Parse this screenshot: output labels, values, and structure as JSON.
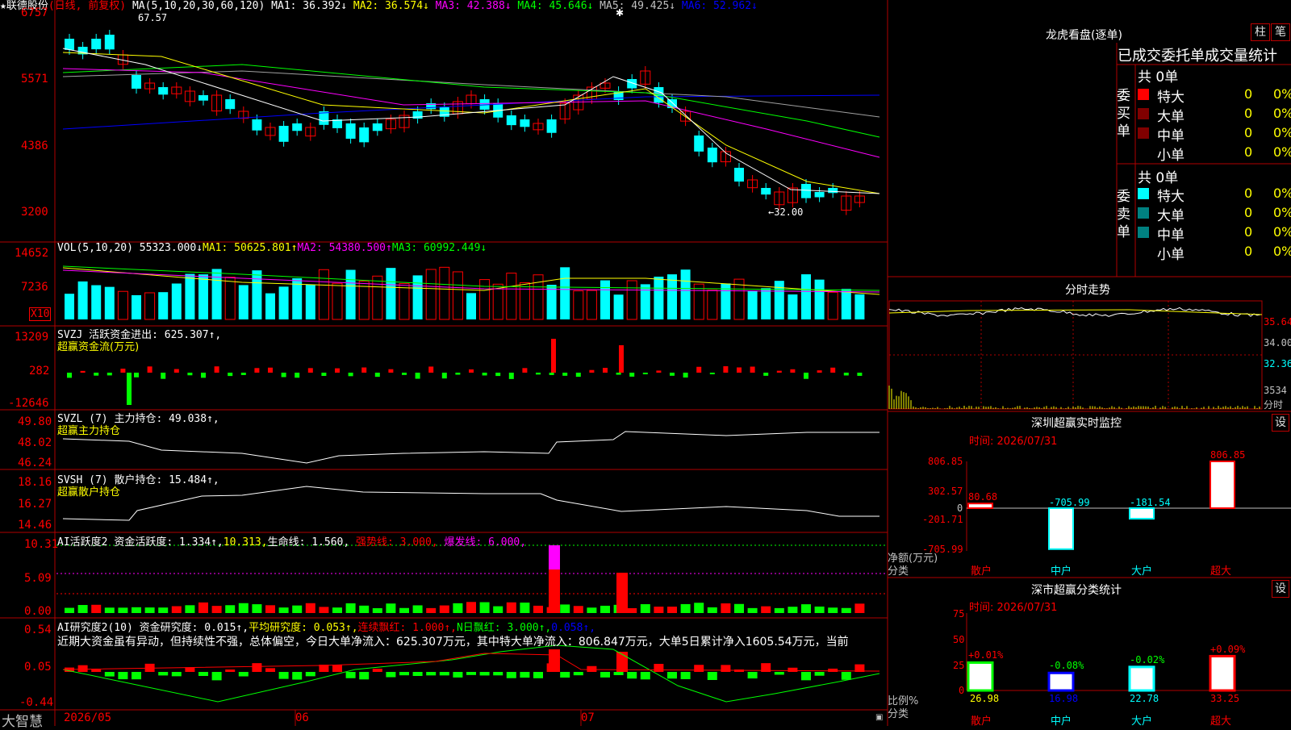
{
  "colors": {
    "up": "#ff0000",
    "down": "#00ffff",
    "ma1": "#ffffff",
    "ma2": "#ffff00",
    "ma3": "#ff00ff",
    "ma4": "#00ff00",
    "ma5": "#a0a0a0",
    "ma6": "#0000ff",
    "grid": "#b00000"
  },
  "header": {
    "stock_name": "★联德股份",
    "period": "(日线, 前复权)",
    "ma_label": "MA(5,10,20,30,60,120)",
    "ma1": "MA1: 36.392↓",
    "ma2": "MA2: 36.574↓",
    "ma3": "MA3: 42.388↓",
    "ma4": "MA4: 45.646↓",
    "ma5": "MA5: 49.425↓",
    "ma6": "MA6: 52.962↓"
  },
  "price_axis": [
    "6757",
    "5571",
    "4386",
    "3200"
  ],
  "price_high_label": "67.57",
  "price_low_label": "←32.00",
  "vol": {
    "label": "VOL(5,10,20)",
    "value": "55323.000↓",
    "ma1": "MA1: 50625.801↑",
    "ma2": "MA2: 54380.500↑",
    "ma3": "MA3: 60992.449↓",
    "axis": [
      "14652",
      "7236"
    ],
    "unit": "X10"
  },
  "svzj": {
    "label": "SVZJ",
    "title": "活跃资金进出: 625.307↑,",
    "subtitle": "超赢资金流(万元)",
    "axis": [
      "13209",
      "282",
      "-12646"
    ]
  },
  "svzl": {
    "label": "SVZL (7)",
    "title": "主力持仓: 49.038↑,",
    "subtitle": "超赢主力持仓",
    "axis": [
      "49.80",
      "48.02",
      "46.24"
    ]
  },
  "svsh": {
    "label": "SVSH (7)",
    "title": "散户持仓: 15.484↑,",
    "subtitle": "超赢散户持仓",
    "axis": [
      "18.16",
      "16.27",
      "14.46"
    ]
  },
  "ai1": {
    "label": "AI活跃度2",
    "t1": "资金活跃度: 1.334↑,",
    "t2": "10.313,",
    "t3": "生命线: 1.560,",
    "t4": "强势线: 3.000,",
    "t5": "爆发线: 6.000,",
    "axis": [
      "10.31",
      "5.09",
      "0.00"
    ]
  },
  "ai2": {
    "label": "AI研究度2(10)",
    "t1": "资金研究度: 0.015↑,",
    "t2": "平均研究度: 0.053↑,",
    "t3": "连续飘红: 1.000↑,",
    "t4": "N日飘红: 3.000↑,",
    "t5": "0.058↑,",
    "commentary": "近期大资金虽有异动，但持续性不强，总体偏空，今日大单净流入：625.307万元，其中特大单净流入：806.847万元，大单5日累计净入1605.54万元，当前",
    "axis": [
      "0.54",
      "0.05",
      "-0.44"
    ]
  },
  "date_axis": {
    "app": "大智慧",
    "d1": "2026/05",
    "d2": "06",
    "d3": "07"
  },
  "right": {
    "lhb_title": "龙虎看盘(逐单)",
    "btn_zhu": "柱",
    "btn_bi": "笔",
    "stat_title": "已成交委托单成交量统计",
    "buy_side": "委买单",
    "sell_side": "委卖单",
    "buy_total": "共 0单",
    "sell_total": "共 0单",
    "buy_rows": [
      {
        "name": "特大",
        "count": "0",
        "pct": "0%",
        "color": "#ff0000"
      },
      {
        "name": "大单",
        "count": "0",
        "pct": "0%",
        "color": "#800000"
      },
      {
        "name": "中单",
        "count": "0",
        "pct": "0%",
        "color": "#800000"
      },
      {
        "name": "小单",
        "count": "0",
        "pct": "0%",
        "color": "#000000"
      }
    ],
    "sell_rows": [
      {
        "name": "特大",
        "count": "0",
        "pct": "0%",
        "color": "#00ffff"
      },
      {
        "name": "大单",
        "count": "0",
        "pct": "0%",
        "color": "#008080"
      },
      {
        "name": "中单",
        "count": "0",
        "pct": "0%",
        "color": "#008080"
      },
      {
        "name": "小单",
        "count": "0",
        "pct": "0%",
        "color": "#000000"
      }
    ],
    "intraday_title": "分时走势",
    "intraday_axis": [
      "35.64",
      "34.00",
      "32.36",
      "3534",
      "分时"
    ],
    "monitor_title": "深圳超赢实时监控",
    "settings_btn": "设",
    "time_label": "时间: 2026/07/31",
    "monitor_axis": [
      "806.85",
      "302.57",
      "0",
      "-201.71",
      "-705.99"
    ],
    "monitor_unit": "净额(万元)",
    "category_label": "分类",
    "categories": [
      "散户",
      "中户",
      "大户",
      "超大"
    ],
    "monitor_values": [
      80.68,
      -705.99,
      -181.54,
      806.85
    ],
    "monitor_labels": [
      "80.68",
      "-705.99",
      "-181.54",
      "806.85"
    ],
    "class_title": "深市超赢分类统计",
    "class_axis": [
      "75",
      "50",
      "25",
      "0"
    ],
    "class_unit": "比例%",
    "class_pct": [
      "+0.01%",
      "-0.08%",
      "-0.02%",
      "+0.09%"
    ],
    "class_values": [
      26.98,
      16.98,
      22.78,
      33.25
    ],
    "class_labels": [
      "26.98",
      "16.98",
      "22.78",
      "33.25"
    ]
  }
}
